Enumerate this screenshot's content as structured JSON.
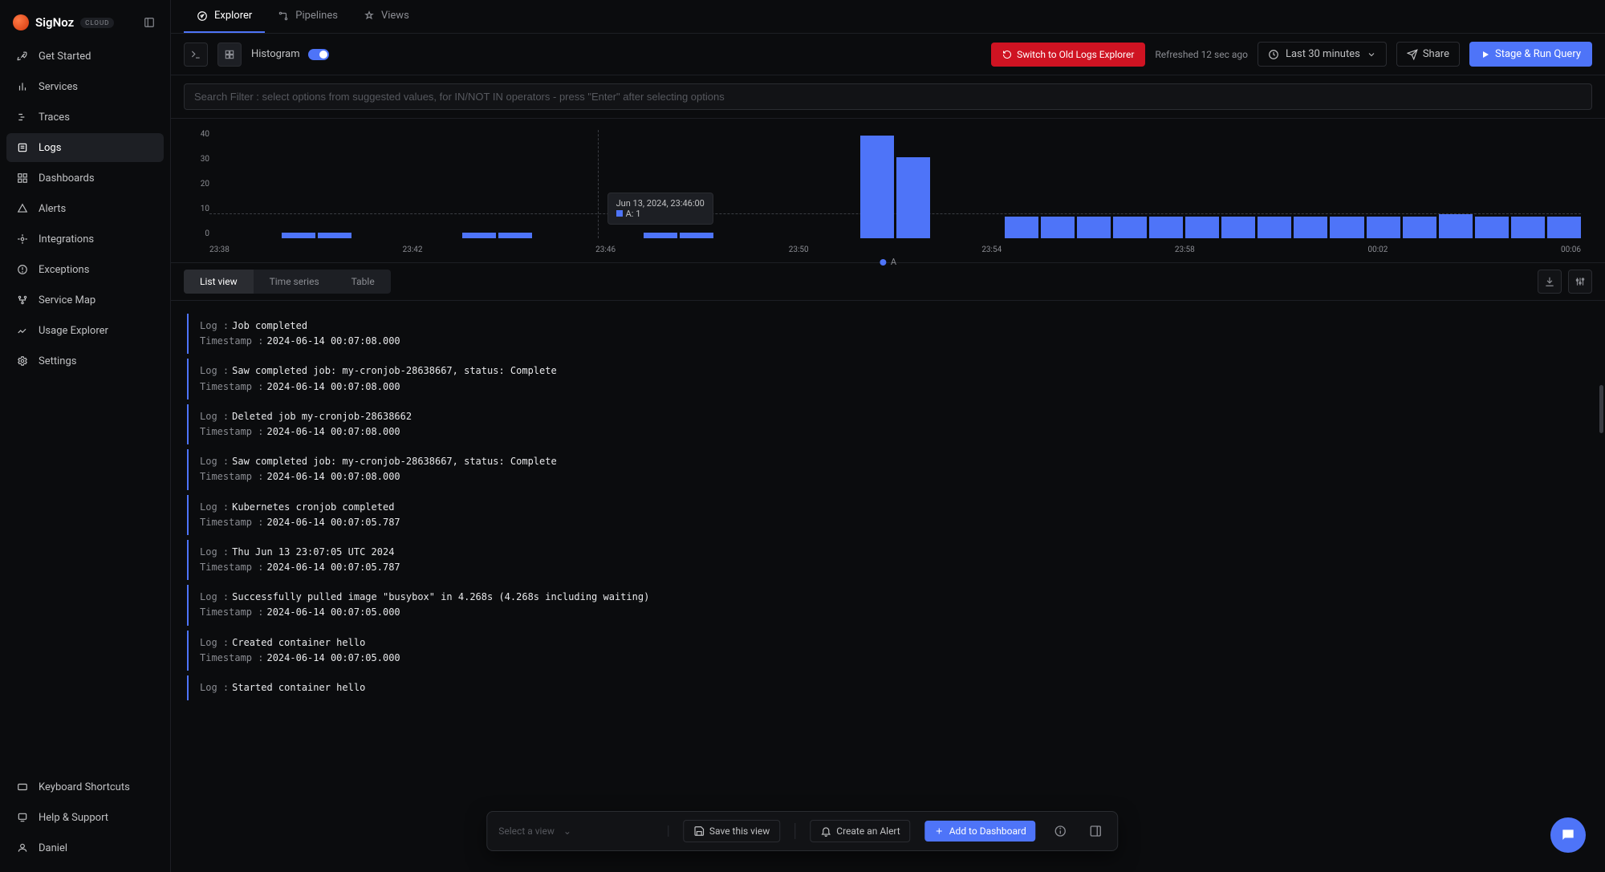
{
  "brand": {
    "name": "SigNoz",
    "badge": "CLOUD"
  },
  "sidebar": {
    "items": [
      {
        "label": "Get Started"
      },
      {
        "label": "Services"
      },
      {
        "label": "Traces"
      },
      {
        "label": "Logs"
      },
      {
        "label": "Dashboards"
      },
      {
        "label": "Alerts"
      },
      {
        "label": "Integrations"
      },
      {
        "label": "Exceptions"
      },
      {
        "label": "Service Map"
      },
      {
        "label": "Usage Explorer"
      },
      {
        "label": "Settings"
      }
    ],
    "bottom": [
      {
        "label": "Keyboard Shortcuts"
      },
      {
        "label": "Help & Support"
      },
      {
        "label": "Daniel"
      }
    ]
  },
  "tabs": [
    {
      "label": "Explorer"
    },
    {
      "label": "Pipelines"
    },
    {
      "label": "Views"
    }
  ],
  "toolbar": {
    "histogram_label": "Histogram",
    "switch_old": "Switch to Old Logs Explorer",
    "refreshed": "Refreshed 12 sec ago",
    "time_range": "Last 30 minutes",
    "share": "Share",
    "stage": "Stage & Run Query"
  },
  "search": {
    "placeholder": "Search Filter : select options from suggested values, for IN/NOT IN operators - press \"Enter\" after selecting options"
  },
  "chart_data": {
    "type": "bar",
    "title": "",
    "xlabel": "",
    "ylabel": "",
    "ylim": [
      0,
      40
    ],
    "y_ticks": [
      40,
      30,
      20,
      10,
      0
    ],
    "x_ticks": [
      "23:38",
      "23:42",
      "23:46",
      "23:50",
      "23:54",
      "23:58",
      "00:02",
      "00:06"
    ],
    "series": [
      {
        "name": "A",
        "values": [
          0,
          0,
          2,
          2,
          0,
          0,
          0,
          2,
          2,
          0,
          0,
          0,
          2,
          2,
          0,
          0,
          0,
          0,
          38,
          30,
          0,
          0,
          8,
          8,
          8,
          8,
          8,
          8,
          8,
          8,
          8,
          8,
          8,
          8,
          9,
          8,
          8,
          8
        ]
      }
    ],
    "tooltip": {
      "time_label": "Jun 13, 2024, 23:46:00",
      "series": "A",
      "value": 1
    },
    "legend": "A"
  },
  "views": {
    "list": "List view",
    "time": "Time series",
    "table": "Table"
  },
  "logs": [
    {
      "msg": "Job completed",
      "ts": "2024-06-14 00:07:08.000"
    },
    {
      "msg": "Saw completed job: my-cronjob-28638667, status: Complete",
      "ts": "2024-06-14 00:07:08.000"
    },
    {
      "msg": "Deleted job my-cronjob-28638662",
      "ts": "2024-06-14 00:07:08.000"
    },
    {
      "msg": "Saw completed job: my-cronjob-28638667, status: Complete",
      "ts": "2024-06-14 00:07:08.000"
    },
    {
      "msg": "Kubernetes cronjob completed",
      "ts": "2024-06-14 00:07:05.787"
    },
    {
      "msg": "Thu Jun 13 23:07:05 UTC 2024",
      "ts": "2024-06-14 00:07:05.787"
    },
    {
      "msg": "Successfully pulled image \"busybox\" in 4.268s (4.268s including waiting)",
      "ts": "2024-06-14 00:07:05.000"
    },
    {
      "msg": "Created container hello",
      "ts": "2024-06-14 00:07:05.000"
    },
    {
      "msg": "Started container hello",
      "ts": ""
    }
  ],
  "log_labels": {
    "log": "Log",
    "ts": "Timestamp"
  },
  "floatbar": {
    "select": "Select a view",
    "save": "Save this view",
    "alert": "Create an Alert",
    "dashboard": "Add to Dashboard"
  }
}
